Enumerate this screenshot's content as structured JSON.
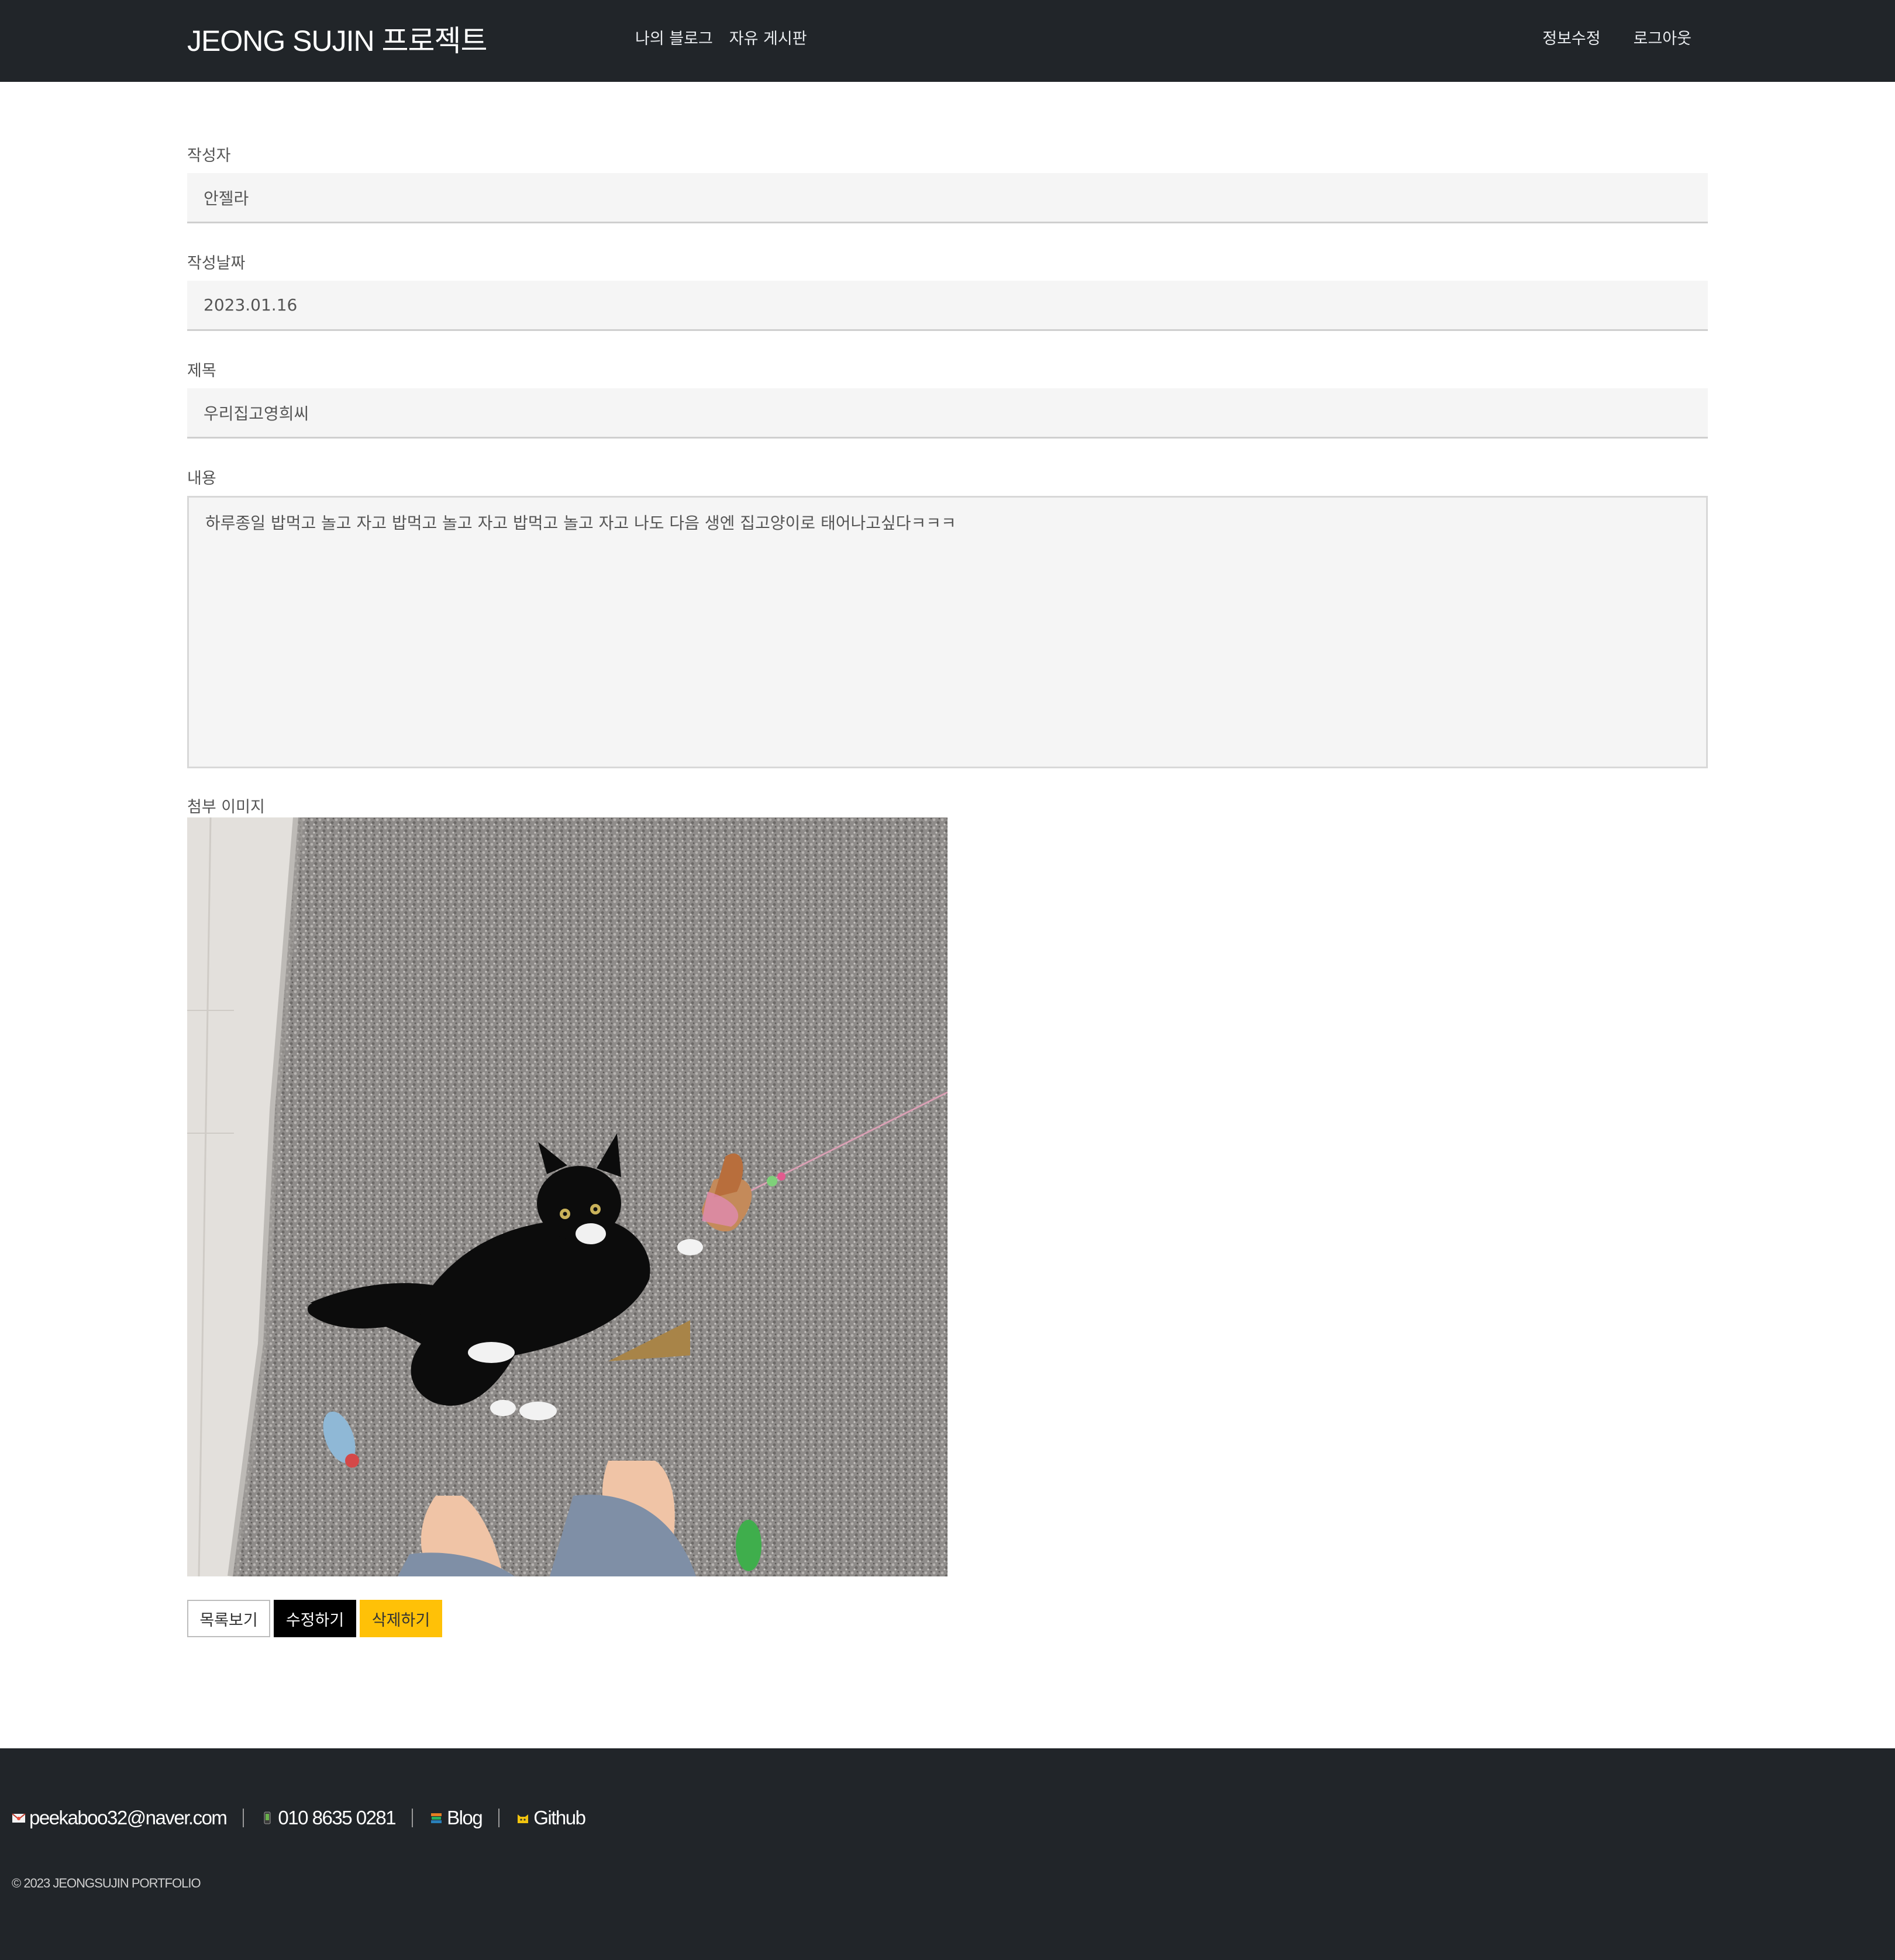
{
  "header": {
    "brand": "JEONG SUJIN 프로젝트",
    "nav_left": [
      "나의 블로그",
      "자유 게시판"
    ],
    "nav_right": [
      "정보수정",
      "로그아웃"
    ],
    "background_color": "#212529"
  },
  "form": {
    "author_label": "작성자",
    "author_value": "안젤라",
    "date_label": "작성날짜",
    "date_value": "2023.01.16",
    "title_label": "제목",
    "title_value": "우리집고영희씨",
    "content_label": "내용",
    "content_value": "하루종일 밥먹고 놀고 자고 밥먹고 놀고 자고 밥먹고 놀고 자고  나도 다음 생엔 집고양이로 태어나고싶다ㅋㅋㅋ",
    "image_label": "첨부 이미지"
  },
  "buttons": {
    "list": "목록보기",
    "edit": "수정하기",
    "delete": "삭제하기",
    "delete_color": "#ffc107"
  },
  "footer": {
    "email": "peekaboo32@naver.com",
    "phone": "010 8635 0281",
    "blog": "Blog",
    "github": "Github",
    "copyright": "© 2023 JEONGSUJIN PORTFOLIO",
    "icons": [
      "mail-icon",
      "phone-icon",
      "books-icon",
      "cat-icon"
    ]
  }
}
